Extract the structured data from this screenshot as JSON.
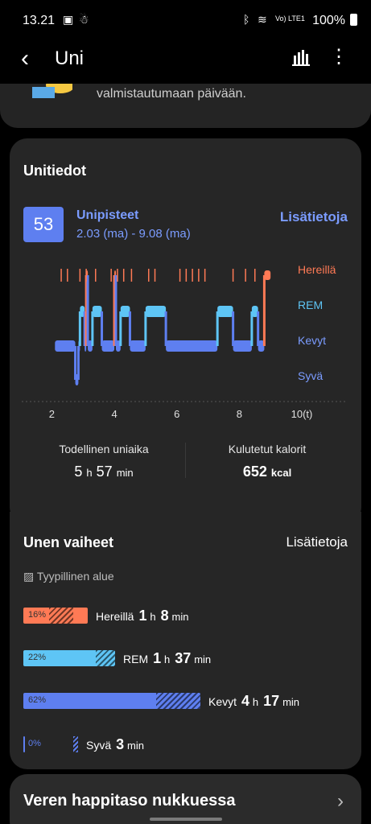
{
  "status": {
    "time": "13.21",
    "battery": "100%",
    "network": "Vo) LTE1"
  },
  "appbar": {
    "title": "Uni"
  },
  "top_card": {
    "text": "valmistautumaan päivään."
  },
  "sleep_info": {
    "title": "Unitiedot",
    "score": "53",
    "score_label": "Unipisteet",
    "date_range": "2.03 (ma) - 9.08 (ma)",
    "more_label": "Lisätietoja",
    "legend": {
      "awake": "Hereillä",
      "rem": "REM",
      "light": "Kevyt",
      "deep": "Syvä"
    },
    "x_ticks": [
      "2",
      "4",
      "6",
      "8",
      "10(t)"
    ],
    "actual_time_label": "Todellinen uniaika",
    "actual_time": {
      "h": "5",
      "h_unit": "h",
      "m": "57",
      "m_unit": "min"
    },
    "calories_label": "Kulutetut kalorit",
    "calories": {
      "value": "652",
      "unit": "kcal"
    }
  },
  "sleep_stages": {
    "title": "Unen vaiheet",
    "more_label": "Lisätietoja",
    "typical_label": "Tyypillinen alue",
    "stages": [
      {
        "name": "Hereillä",
        "pct": "16%",
        "h": "1",
        "m": "8",
        "color": "#ff7a55"
      },
      {
        "name": "REM",
        "pct": "22%",
        "h": "1",
        "m": "37",
        "color": "#5ec5f5"
      },
      {
        "name": "Kevyt",
        "pct": "62%",
        "h": "4",
        "m": "17",
        "color": "#5e7ff0"
      },
      {
        "name": "Syvä",
        "pct": "0%",
        "m": "3",
        "color": "#5e7ff0"
      }
    ],
    "h_unit": "h",
    "m_unit": "min"
  },
  "bottom_card": {
    "title": "Veren happitaso nukkuessa"
  },
  "chart_data": {
    "type": "line",
    "title": "",
    "xlabel": "",
    "ylabel": "",
    "x_ticks": [
      "2",
      "4",
      "6",
      "8",
      "10(t)"
    ],
    "y_categories": [
      "Hereillä",
      "REM",
      "Kevyt",
      "Syvä"
    ],
    "xlim": [
      1.5,
      10
    ],
    "series": [
      {
        "values": [
          [
            2.1,
            "Kevyt"
          ],
          [
            2.75,
            "Syvä"
          ],
          [
            2.85,
            "Kevyt"
          ],
          [
            2.9,
            "REM"
          ],
          [
            3.05,
            "Kevyt"
          ],
          [
            3.1,
            "Hereillä"
          ],
          [
            3.15,
            "Kevyt"
          ],
          [
            3.3,
            "REM"
          ],
          [
            3.6,
            "Kevyt"
          ],
          [
            4.0,
            "Hereillä"
          ],
          [
            4.05,
            "Kevyt"
          ],
          [
            4.2,
            "REM"
          ],
          [
            4.5,
            "Kevyt"
          ],
          [
            5.0,
            "REM"
          ],
          [
            5.65,
            "Kevyt"
          ],
          [
            7.3,
            "REM"
          ],
          [
            7.8,
            "Kevyt"
          ],
          [
            8.4,
            "REM"
          ],
          [
            8.6,
            "Kevyt"
          ],
          [
            8.8,
            "Hereillä"
          ],
          [
            9.0,
            "Hereillä"
          ]
        ]
      }
    ]
  }
}
